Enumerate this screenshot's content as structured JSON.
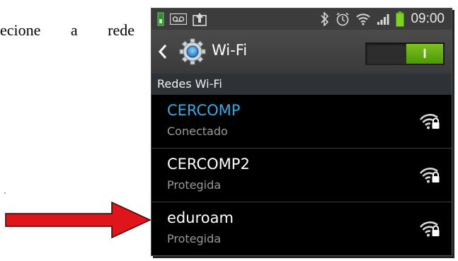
{
  "document": {
    "text": "ecione a rede"
  },
  "status_bar": {
    "time": "09:00",
    "battery_color": "#7ed321",
    "icons": [
      "sim-icon",
      "voicemail-icon",
      "upload-icon",
      "bluetooth-icon",
      "alarm-icon",
      "wifi-icon",
      "signal-icon",
      "battery-icon"
    ]
  },
  "action_bar": {
    "title": "Wi-Fi",
    "toggle_label": "I",
    "toggle_state": "on"
  },
  "section": {
    "header": "Redes Wi-Fi"
  },
  "networks": [
    {
      "name": "CERCOMP",
      "status": "Conectado",
      "connected": true,
      "secured": true
    },
    {
      "name": "CERCOMP2",
      "status": "Protegida",
      "connected": false,
      "secured": true
    },
    {
      "name": "eduroam",
      "status": "Protegida",
      "connected": false,
      "secured": true
    }
  ],
  "colors": {
    "connected": "#3aa9e6",
    "accent_toggle": "#5fa815",
    "annotation_arrow": "#e0141b"
  }
}
